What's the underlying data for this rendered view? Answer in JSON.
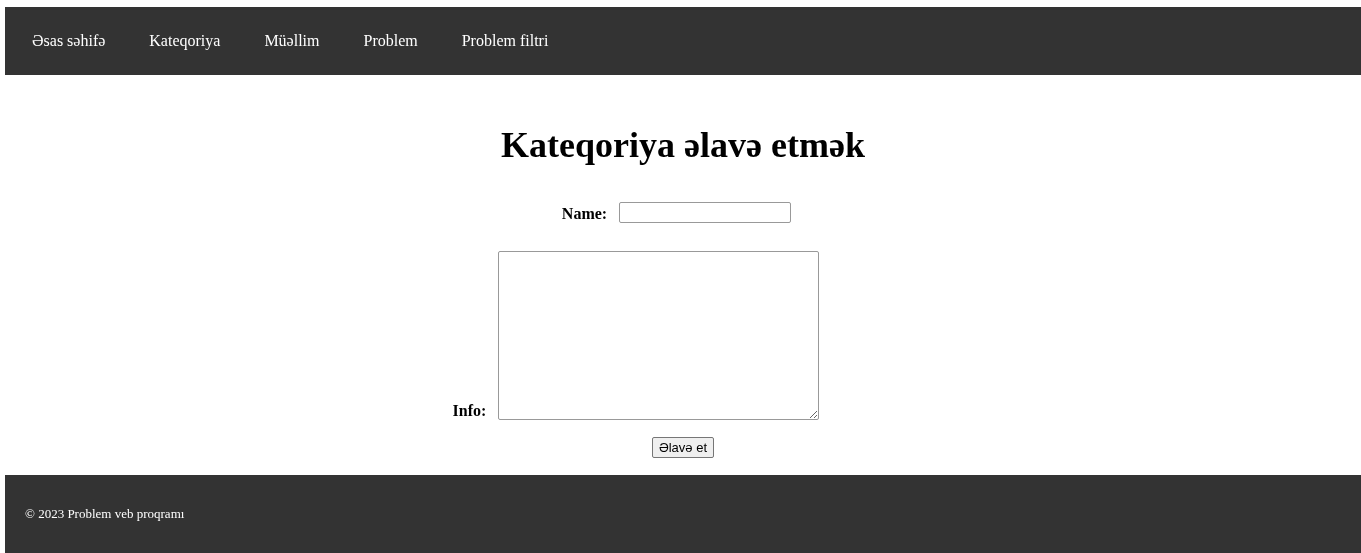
{
  "nav": [
    "Əsas səhifə",
    "Kateqoriya",
    "Müəllim",
    "Problem",
    "Problem filtri"
  ],
  "title": "Kateqoriya əlavə etmək",
  "form": {
    "name_label": "Name:",
    "info_label": "Info:",
    "submit": "Əlavə et"
  },
  "footer": "© 2023 Problem veb proqramı"
}
